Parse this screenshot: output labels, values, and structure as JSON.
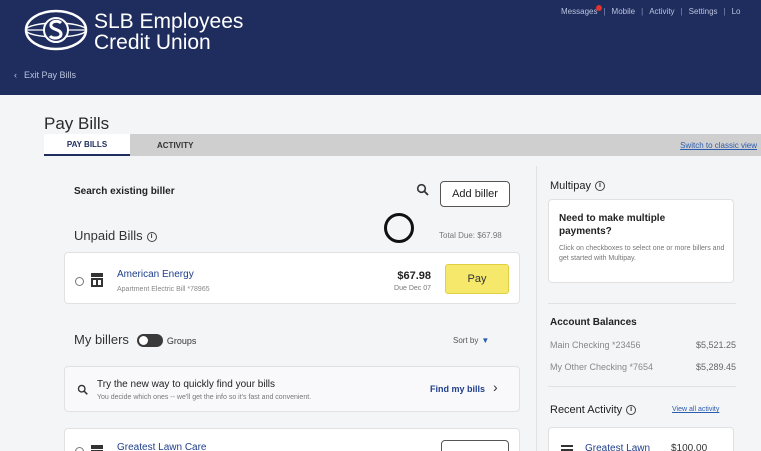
{
  "header": {
    "brand_line1": "SLB Employees",
    "brand_line2": "Credit Union",
    "back_link": "Exit Pay Bills",
    "nav": [
      "Messages",
      "Mobile",
      "Activity",
      "Settings",
      "Lo"
    ]
  },
  "page": {
    "title": "Pay Bills",
    "tabs": [
      "PAY BILLS",
      "ACTIVITY"
    ],
    "classic_view": "Switch to classic view"
  },
  "search": {
    "label": "Search existing biller",
    "add_biller": "Add biller"
  },
  "unpaid": {
    "title": "Unpaid Bills",
    "total_due": "Total Due: $67.98",
    "bills": [
      {
        "name": "American Energy",
        "subtitle": "Apartment Electric Bill *78965",
        "amount": "$67.98",
        "due": "Due Dec 07",
        "pay_label": "Pay"
      }
    ]
  },
  "my_billers": {
    "title": "My billers",
    "groups_label": "Groups",
    "sort_by": "Sort by",
    "promo_title": "Try the new way to quickly find your bills",
    "promo_subtitle": "You decide which ones -- we'll get the info so it's fast and convenient.",
    "find_link": "Find my bills",
    "billers": [
      {
        "name": "Greatest Lawn Care"
      }
    ]
  },
  "multipay": {
    "title": "Multipay",
    "question": "Need to make multiple payments?",
    "description": "Click on checkboxes to select one or more billers and get started with Multipay."
  },
  "balances": {
    "title": "Account Balances",
    "accounts": [
      {
        "name": "Main Checking *23456",
        "balance": "$5,521.25"
      },
      {
        "name": "My Other Checking *7654",
        "balance": "$5,289.45"
      }
    ]
  },
  "recent": {
    "title": "Recent Activity",
    "view_all": "View all activity",
    "items": [
      {
        "name": "Greatest Lawn",
        "amount": "$100.00"
      }
    ]
  },
  "colors": {
    "header_bg": "#1f2d5e",
    "pay_button": "#f5e86b",
    "link": "#2a5db0"
  }
}
